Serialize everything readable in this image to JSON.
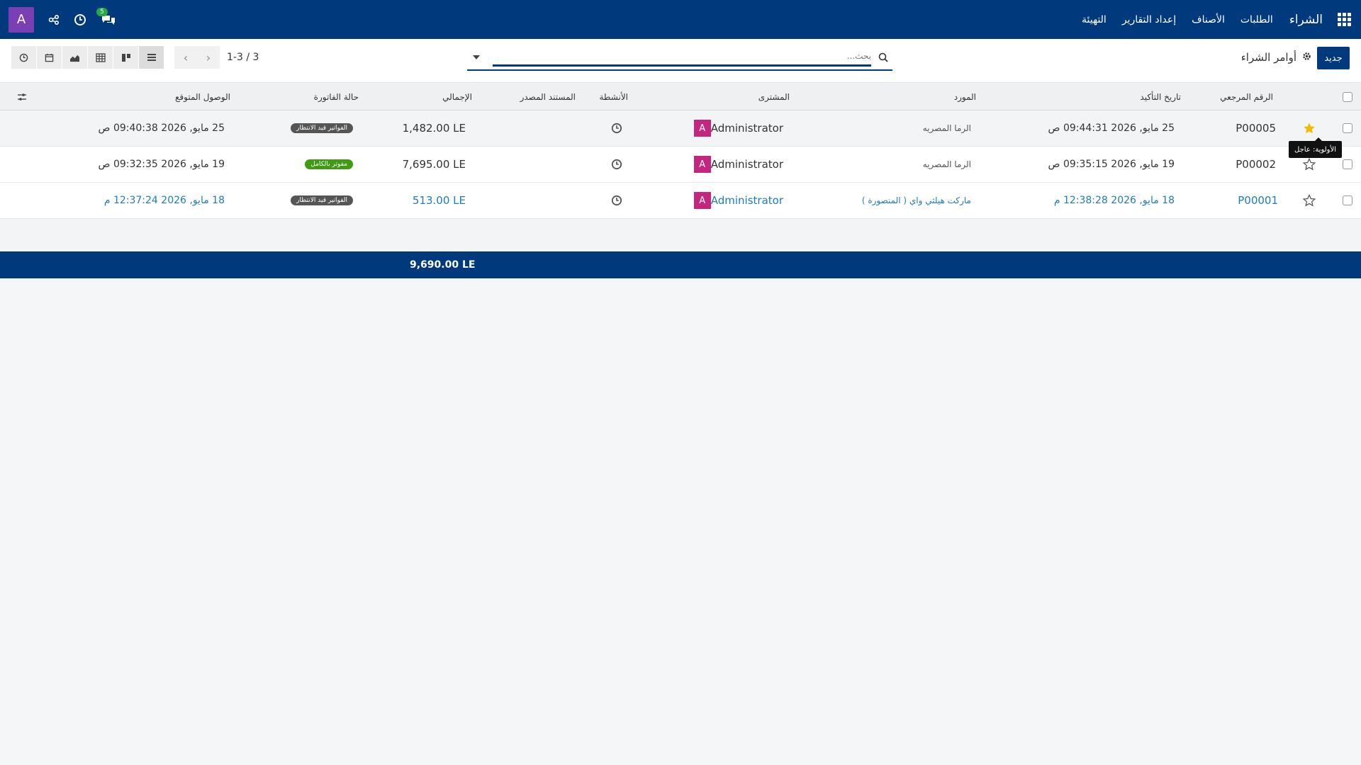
{
  "topbar": {
    "brand": "الشراء",
    "menu": [
      "الطلبات",
      "الأصناف",
      "إعداد التقارير",
      "التهيئة"
    ],
    "user_initial": "A",
    "chat_count": "5"
  },
  "control": {
    "new_label": "جديد",
    "breadcrumb": "أوامر الشراء",
    "search_placeholder": "بحث...",
    "pager_value": "1-3 / 3"
  },
  "table": {
    "headers": {
      "reference": "الرقم المرجعي",
      "confirm_date": "تاريخ التأكيد",
      "vendor": "المورد",
      "buyer": "المشترى",
      "activities": "الأنشطة",
      "source": "المستند المصدر",
      "total": "الإجمالي",
      "invoice_status": "حالة الفاتورة",
      "expected_arrival": "الوصول المتوقع"
    },
    "rows": [
      {
        "reference": "P00005",
        "confirm_date": "25 مايو, 2026 09:44:31 ص",
        "vendor": "الرما المصريه",
        "buyer": "Administrator",
        "buyer_initial": "A",
        "source": "",
        "total": "1,482.00 LE",
        "invoice_status": "الفواتير قيد الانتظار",
        "expected_arrival": "25 مايو, 2026 09:40:38 ص",
        "starred": true
      },
      {
        "reference": "P00002",
        "confirm_date": "19 مايو, 2026 09:35:15 ص",
        "vendor": "الرما المصريه",
        "buyer": "Administrator",
        "buyer_initial": "A",
        "source": "",
        "total": "7,695.00 LE",
        "invoice_status": "مفوتر بالكامل",
        "expected_arrival": "19 مايو, 2026 09:32:35 ص",
        "starred": false
      },
      {
        "reference": "P00001",
        "confirm_date": "18 مايو, 2026 12:38:28 م",
        "vendor": "ماركت هيلثي واي ( المنصورة )",
        "buyer": "Administrator",
        "buyer_initial": "A",
        "source": "",
        "total": "513.00 LE",
        "invoice_status": "الفواتير قيد الانتظار",
        "expected_arrival": "18 مايو, 2026 12:37:24 م",
        "starred": false
      }
    ],
    "grand_total": "9,690.00 LE"
  },
  "tooltip": "الأولوية: عاجل",
  "colors": {
    "primary": "#003a7d",
    "buyer_avatar": "#c5267d",
    "link": "#1b7dbd",
    "star": "#f3bb00",
    "paid": "#3f9b13"
  }
}
